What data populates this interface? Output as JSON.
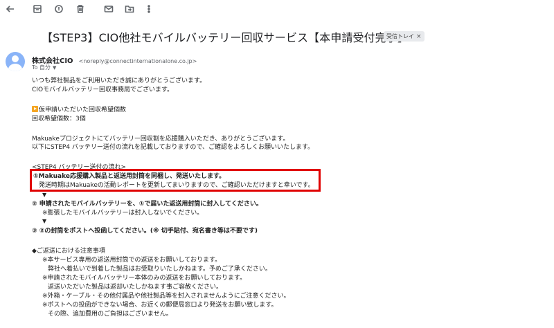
{
  "toolbar": {
    "icons": [
      "back-arrow-icon",
      "archive-icon",
      "report-spam-icon",
      "delete-icon",
      "mark-unread-icon",
      "move-to-icon",
      "more-vert-icon"
    ]
  },
  "email": {
    "subject": "【STEP3】CIO他社モバイルバッテリー回収サービス【本申請受付完了】",
    "label": "受信トレイ",
    "label_close": "×",
    "sender_name": "株式会社CIO",
    "sender_email": "<noreply@connectinternationalone.co.jp>",
    "to": "To 自分",
    "to_caret": "▼",
    "body": {
      "greeting1": "いつも弊社製品をご利用いただき誠にありがとうございます。",
      "greeting2": "CIOモバイルバッテリー回収事務局でございます。",
      "desired_heading": "仮申請いただいた回収希望個数",
      "desired_count": "回収希望個数：3個",
      "makuake1": "Makuakeプロジェクトにてバッテリー回収割を応援購入いただき、ありがとうございます。",
      "makuake2": "以下にSTEP4 バッテリー送付の流れを記載しておりますので、ご確認をよろしくお願いいたします。",
      "flow_heading": "<STEP4 バッテリー送付の流れ>",
      "step1": "①Makuake応援購入製品と返送用封筒を同梱し、発送いたします。",
      "step1_note": "発送時期はMakuakeの活動レポートを更新してまいりますので、ご確認いただけますと幸いです。",
      "arrow": "▼",
      "step2": "② 申請されたモバイルバッテリーを、①で届いた返送用封筒に封入してください。",
      "step2_note": "※膨張したモバイルバッテリーは封入しないでください。",
      "step3": "③ ②の封筒をポストへ投函してください。(※ 切手貼付、宛名書き等は不要です)",
      "notes_heading": "◆ご返送における注意事項",
      "notes": [
        "※本サービス専用の返送用封筒での返送をお願いしております。",
        "弊社へ着払いで到着した製品はお受取りいたしかねます。予めご了承ください。",
        "※申請されたモバイルバッテリー本体のみの返送をお願いしております。",
        "返送いただいた製品は返却いたしかねます事ご容赦ください。",
        "※外箱・ケーブル・その他付属品や他社製品等を封入されませんようにご注意ください。",
        "※ポストへの投函ができない場合、お近くの郵便局窓口より発送をお願い致します。",
        "その際、追加費用のご負担はございません。"
      ]
    }
  },
  "colors": {
    "highlight": "#e00000",
    "avatar": "#8ab4f8",
    "icon": "#5f6368"
  }
}
